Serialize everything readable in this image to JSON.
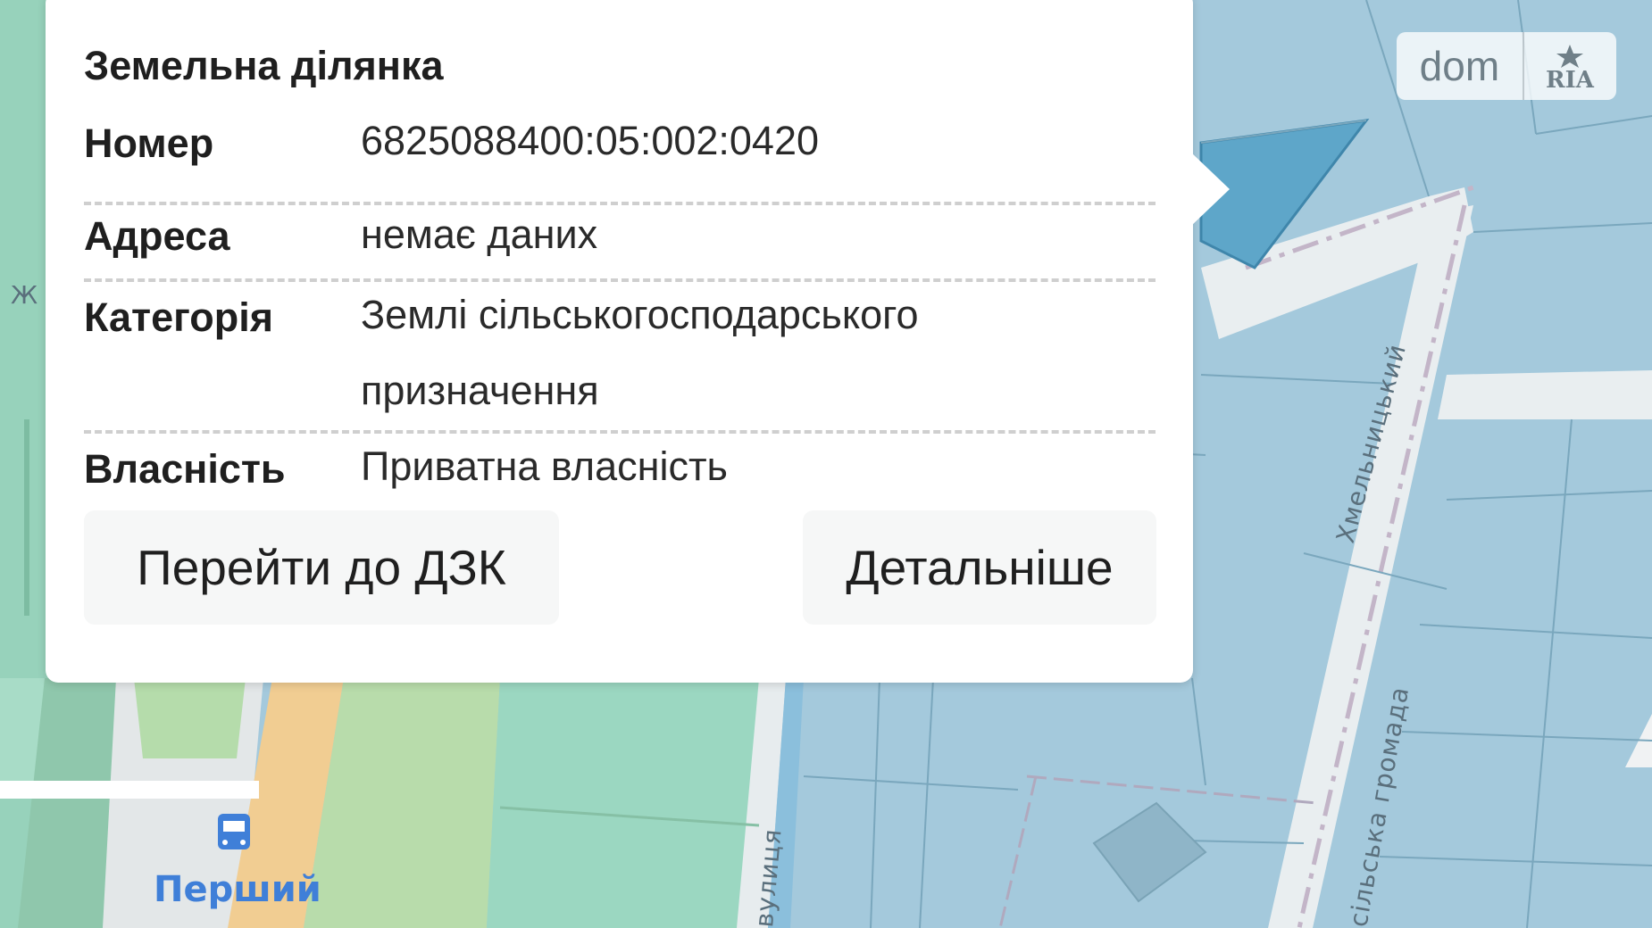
{
  "popup": {
    "title": "Земельна ділянка",
    "rows": [
      {
        "key": "Номер",
        "value": "6825088400:05:002:0420"
      },
      {
        "key": "Адреса",
        "value": "немає даних"
      },
      {
        "key": "Категорія",
        "value": "Землі сільськогосподарського призначення"
      },
      {
        "key": "Власність",
        "value": "Приватна власність"
      }
    ],
    "buttons": {
      "go_to_dzk": "Перейти до ДЗК",
      "details": "Детальніше"
    }
  },
  "map": {
    "street_labels": {
      "khmelnytskyi": "Хмельницький",
      "silska_hromada": "сільська громада",
      "vulytsia": "вулиця"
    },
    "stop_label": "Перший",
    "edge_letter": "Ж",
    "colors": {
      "parcel_fill": "#a4c9dc",
      "selected_parcel": "#5ea6c9",
      "green_area": "#9ad4bd",
      "road": "#e9eef0",
      "main_road": "#f2cf95"
    },
    "icons": [
      "bus-stop-icon"
    ]
  },
  "logo": {
    "dom": "dom",
    "ria": "RIA"
  }
}
